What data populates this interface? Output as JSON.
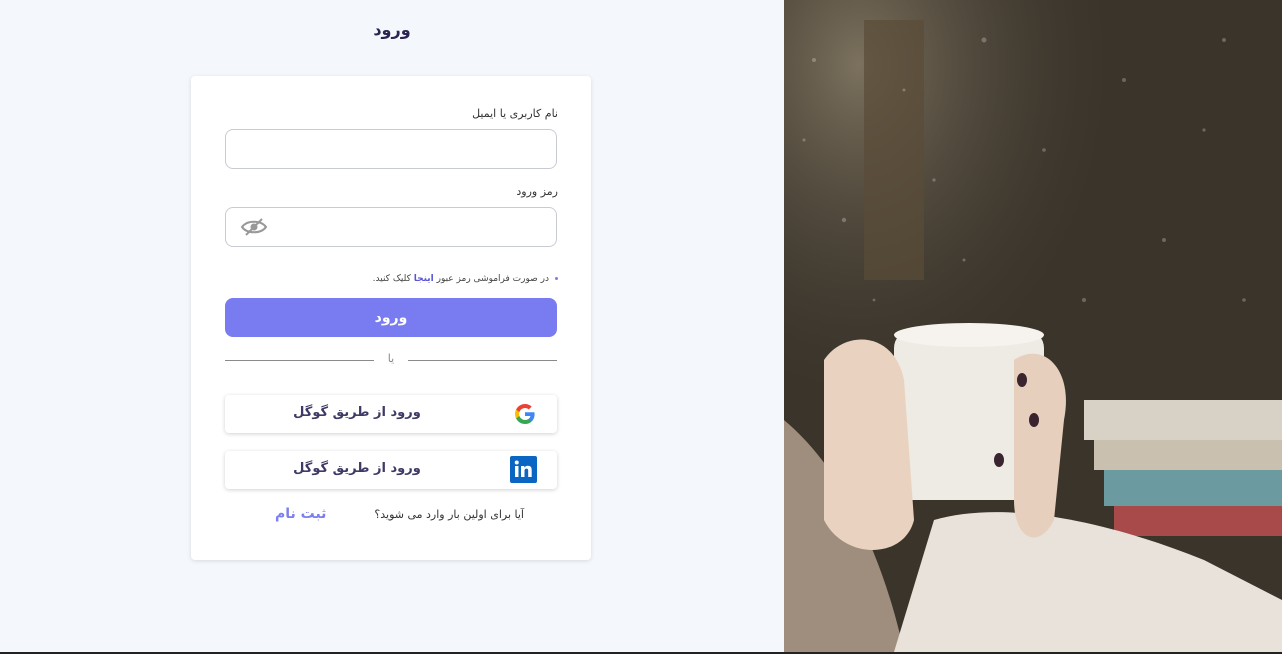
{
  "page": {
    "title": "ورود"
  },
  "form": {
    "username_label": "نام کاربری یا ایمیل",
    "username_value": "",
    "password_label": "رمز ورود",
    "password_value": "",
    "forgot_prefix": "در صورت فراموشی رمز عبور ",
    "forgot_link": "اینجا",
    "forgot_suffix": " کلیک کنید.",
    "submit_label": "ورود",
    "divider_text": "یا"
  },
  "social": [
    {
      "label": "ورود از طریق گوگل",
      "icon": "google-icon"
    },
    {
      "label": "ورود از طریق گوگل",
      "icon": "linkedin-icon"
    }
  ],
  "signup": {
    "prompt": "آیا برای اولین بار وارد می شوید؟",
    "link": "ثبت نام"
  },
  "colors": {
    "accent": "#787cf0",
    "page_bg": "#f4f7fc",
    "title": "#2b2350",
    "linkedin": "#0a66c2"
  },
  "hero_image": {
    "subject": "hands holding a white mug behind a rainy window"
  }
}
